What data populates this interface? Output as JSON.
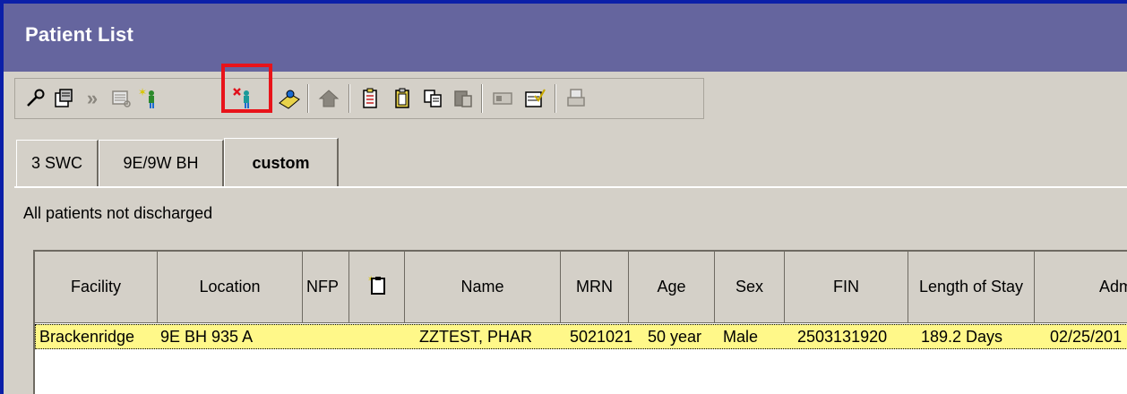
{
  "window": {
    "title": "Patient List"
  },
  "toolbar": {
    "icons": [
      "properties-wrench-icon",
      "properties-sheet-icon",
      "forward-arrows-icon",
      "view-list-icon",
      "add-patient-icon",
      "remove-patient-icon",
      "patient-locator-icon",
      "home-icon",
      "notes-checklist-icon",
      "clipboard-icon",
      "copy-icon",
      "paste-icon",
      "column-settings-icon",
      "checklist-sheet-icon",
      "print-icon"
    ],
    "highlighted": "remove-patient-icon"
  },
  "tabs": [
    {
      "label": "3 SWC"
    },
    {
      "label": "9E/9W BH"
    },
    {
      "label": "custom",
      "active": true
    }
  ],
  "list": {
    "filter_text": "All  patients not discharged",
    "columns": [
      "Facility",
      "Location",
      "NFP",
      "",
      "Name",
      "MRN",
      "Age",
      "Sex",
      "FIN",
      "Length of Stay",
      "Adm"
    ],
    "rows": [
      {
        "facility": "Brackenridge",
        "location": "9E BH 935 A",
        "nfp": "",
        "note": "",
        "name": "ZZTEST, PHAR",
        "mrn": "5021021",
        "age": "50 year",
        "sex": "Male",
        "fin": "2503131920",
        "los": "189.2 Days",
        "adm": "02/25/201"
      }
    ]
  },
  "colors": {
    "titlebar": "#65659e",
    "selected_row": "#fff889",
    "highlight": "#e8131a",
    "window_border": "#0b1fa8"
  }
}
